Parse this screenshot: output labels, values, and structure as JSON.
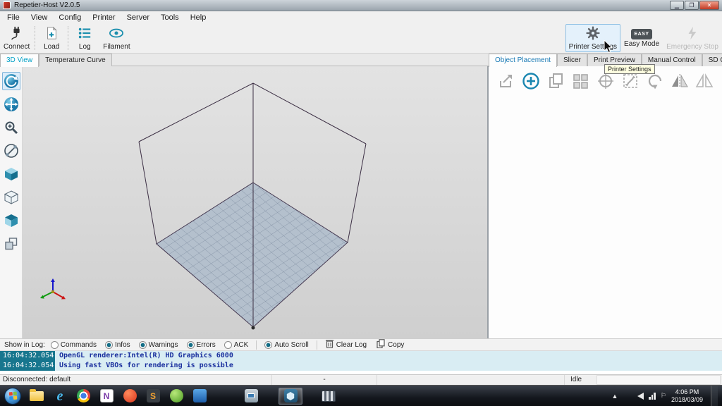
{
  "window": {
    "title": "Repetier-Host V2.0.5"
  },
  "menu": {
    "items": [
      "File",
      "View",
      "Config",
      "Printer",
      "Server",
      "Tools",
      "Help"
    ]
  },
  "toolbar": {
    "connect": "Connect",
    "load": "Load",
    "log": "Log",
    "filament": "Filament",
    "printer_settings": "Printer Settings",
    "easy_mode": "Easy Mode",
    "easy_badge": "EASY",
    "emergency_stop": "Emergency Stop",
    "tooltip": "Printer Settings"
  },
  "view_tabs": {
    "active": "3D View",
    "tabs": [
      "3D View",
      "Temperature Curve"
    ]
  },
  "right_tabs": {
    "active": "Object Placement",
    "tabs": [
      "Object Placement",
      "Slicer",
      "Print Preview",
      "Manual Control",
      "SD Card"
    ]
  },
  "log": {
    "label": "Show in Log:",
    "filters": [
      {
        "label": "Commands",
        "checked": false
      },
      {
        "label": "Infos",
        "checked": true
      },
      {
        "label": "Warnings",
        "checked": true
      },
      {
        "label": "Errors",
        "checked": true
      },
      {
        "label": "ACK",
        "checked": false
      },
      {
        "label": "Auto Scroll",
        "checked": true
      }
    ],
    "clear_label": "Clear Log",
    "copy_label": "Copy",
    "entries": [
      {
        "time": "16:04:32.054",
        "message": "OpenGL renderer:Intel(R) HD Graphics 6000"
      },
      {
        "time": "16:04:32.054",
        "message": "Using fast VBOs for rendering is possible"
      }
    ]
  },
  "status": {
    "left": "Disconnected: default",
    "middle": "-",
    "idle": "Idle"
  },
  "taskbar": {
    "time": "4:06 PM",
    "date": "2018/03/09"
  },
  "colors": {
    "accent_teal": "#1b8fae",
    "tab_active_left": "#00a0c6",
    "tab_active_right": "#1a7ab5",
    "tooltip_bg": "#ffffe1",
    "log_time_bg": "#17768e",
    "log_msg_color": "#1a2f9e",
    "bed_fill": "#b4c0cd"
  }
}
